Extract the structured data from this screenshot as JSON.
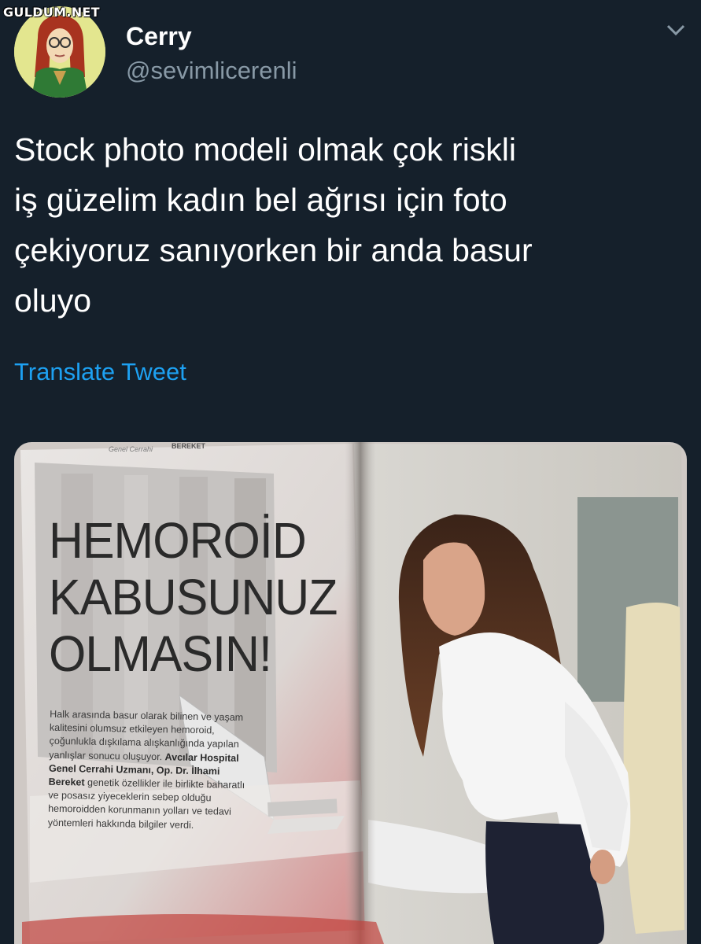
{
  "watermark": "GULDUM.NET",
  "tweet": {
    "display_name": "Cerry",
    "handle": "@sevimlicerenli",
    "lines": [
      "Stock photo modeli olmak çok riskli",
      "iş güzelim kadın bel ağrısı için foto",
      "çekiyoruz sanıyorken bir anda basur",
      "oluyo"
    ],
    "translate_label": "Translate Tweet"
  },
  "magazine": {
    "author": "Genel Cerrahi",
    "header_fragment": "BEREKET",
    "headline": [
      "HEMOROİD",
      "KABUSUNUZ",
      "OLMASIN!"
    ],
    "body_intro": "Halk arasında basur olarak bilinen ve yaşam kalitesini olumsuz etkileyen hemoroid, çoğunlukla dışkılama alışkanlığında yapılan yanlışlar sonucu oluşuyor.",
    "body_bold": "Avcılar Hospital Genel Cerrahi Uzmanı, Op. Dr. İlhami Bereket",
    "body_rest": "genetik özellikler ile birlikte baharatlı ve posasız yiyeceklerin sebep olduğu hemoroidden korunmanın yolları ve tedavi yöntemleri hakkında bilgiler verdi."
  },
  "colors": {
    "background": "#15202b",
    "text_primary": "#ffffff",
    "text_secondary": "#8899a6",
    "link": "#1da1f2"
  },
  "icons": {
    "menu": "chevron-down-icon",
    "avatar": "cartoon-girl-avatar"
  }
}
